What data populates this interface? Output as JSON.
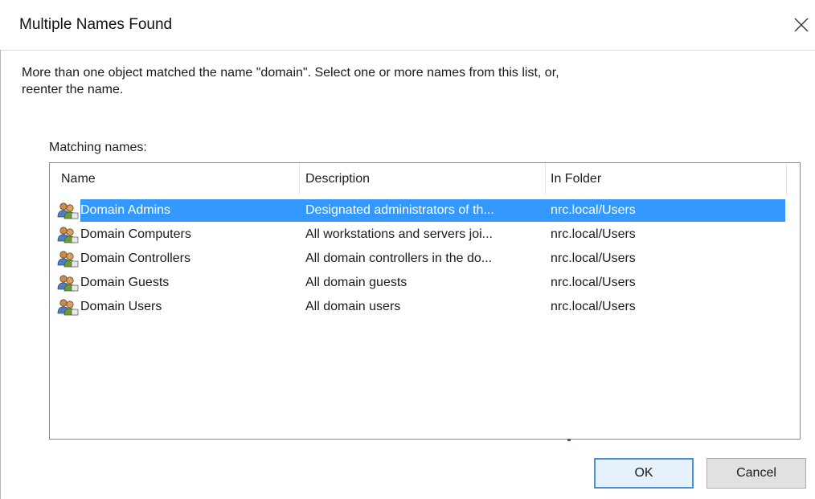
{
  "dialog": {
    "title": "Multiple Names Found",
    "close_icon": "close-icon",
    "instructions": "More than one object matched the name \"domain\". Select one or more names from this list, or, reenter the name.",
    "matching_label": "Matching names:",
    "columns": [
      "Name",
      "Description",
      "In Folder"
    ],
    "rows": [
      {
        "name": "Domain Admins",
        "description": "Designated administrators of th...",
        "folder": "nrc.local/Users",
        "icon": "group-icon",
        "selected": true
      },
      {
        "name": "Domain Computers",
        "description": "All workstations and servers joi...",
        "folder": "nrc.local/Users",
        "icon": "group-icon",
        "selected": false
      },
      {
        "name": "Domain Controllers",
        "description": "All domain controllers in the do...",
        "folder": "nrc.local/Users",
        "icon": "group-icon",
        "selected": false
      },
      {
        "name": "Domain Guests",
        "description": "All domain guests",
        "folder": "nrc.local/Users",
        "icon": "group-icon",
        "selected": false
      },
      {
        "name": "Domain Users",
        "description": "All domain users",
        "folder": "nrc.local/Users",
        "icon": "group-icon",
        "selected": false
      }
    ],
    "ok_label": "OK",
    "cancel_label": "Cancel",
    "selection_color": "#3399ff"
  }
}
